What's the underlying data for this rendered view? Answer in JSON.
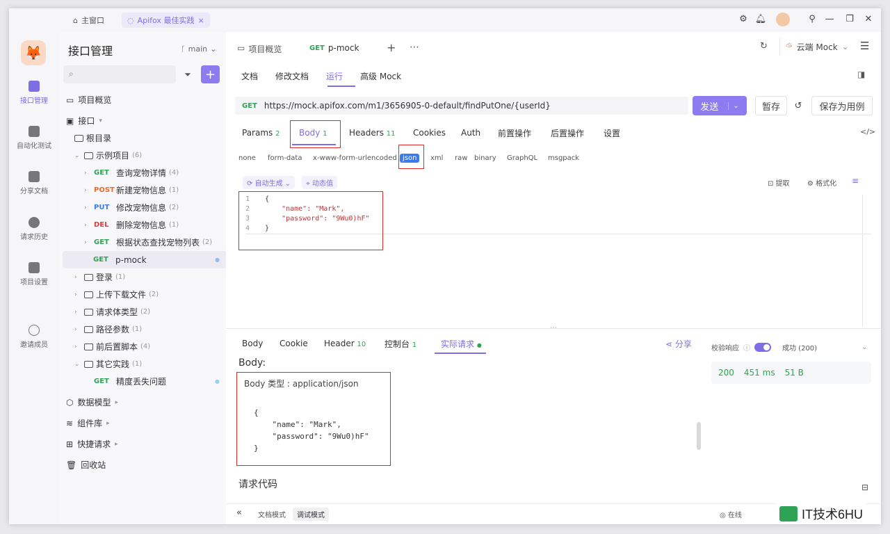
{
  "titlebar": {
    "home_tab": "主窗口",
    "active_tab": "Apifox 最佳实践"
  },
  "rail": {
    "items": [
      {
        "label": "接口管理"
      },
      {
        "label": "自动化测试"
      },
      {
        "label": "分享文档"
      },
      {
        "label": "请求历史"
      },
      {
        "label": "项目设置"
      },
      {
        "label": "邀请成员"
      }
    ]
  },
  "sidebar": {
    "title": "接口管理",
    "branch": "main",
    "items": {
      "overview": "项目概览",
      "api": "接口",
      "root": "根目录",
      "example": {
        "label": "示例项目",
        "count": "(6)"
      },
      "e1": {
        "method": "GET",
        "label": "查询宠物详情",
        "count": "(4)"
      },
      "e2": {
        "method": "POST",
        "label": "新建宠物信息",
        "count": "(1)"
      },
      "e3": {
        "method": "PUT",
        "label": "修改宠物信息",
        "count": "(2)"
      },
      "e4": {
        "method": "DEL",
        "label": "删除宠物信息",
        "count": "(1)"
      },
      "e5": {
        "method": "GET",
        "label": "根据状态查找宠物列表",
        "count": "(2)"
      },
      "e6": {
        "method": "GET",
        "label": "p-mock"
      },
      "login": {
        "label": "登录",
        "count": "(1)"
      },
      "upload": {
        "label": "上传下载文件",
        "count": "(2)"
      },
      "bodytype": {
        "label": "请求体类型",
        "count": "(2)"
      },
      "pathparam": {
        "label": "路径参数",
        "count": "(1)"
      },
      "prepost": {
        "label": "前后置脚本",
        "count": "(4)"
      },
      "other": {
        "label": "其它实践",
        "count": "(1)"
      },
      "o1": {
        "method": "GET",
        "label": "精度丢失问题"
      },
      "datamodel": "数据模型",
      "components": "组件库",
      "quick": "快捷请求",
      "trash": "回收站"
    }
  },
  "main": {
    "tabs": {
      "overview": "项目概览",
      "active_method": "GET",
      "active_name": "p-mock"
    },
    "env": "云端 Mock",
    "subtabs": [
      "文档",
      "修改文档",
      "运行",
      "高级 Mock"
    ],
    "request": {
      "method": "GET",
      "url": "https://mock.apifox.com/m1/3656905-0-default/findPutOne/{userId}",
      "send": "发送",
      "save": "暂存",
      "save_case": "保存为用例"
    },
    "param_tabs": [
      {
        "label": "Params",
        "count": "2"
      },
      {
        "label": "Body",
        "count": "1"
      },
      {
        "label": "Headers",
        "count": "11"
      },
      {
        "label": "Cookies",
        "count": ""
      },
      {
        "label": "Auth",
        "count": ""
      },
      {
        "label": "前置操作",
        "count": ""
      },
      {
        "label": "后置操作",
        "count": ""
      },
      {
        "label": "设置",
        "count": ""
      }
    ],
    "body_types": [
      "none",
      "form-data",
      "x-www-form-urlencoded",
      "json",
      "xml",
      "raw",
      "binary",
      "GraphQL",
      "msgpack"
    ],
    "toolbar": {
      "auto": "自动生成",
      "dynamic": "动态值",
      "extract": "提取",
      "format": "格式化"
    },
    "editor_lines": [
      {
        "n": "1",
        "t": "{"
      },
      {
        "n": "2",
        "t": "    \"name\": \"Mark\","
      },
      {
        "n": "3",
        "t": "    \"password\": \"9Wu0)hF\""
      },
      {
        "n": "4",
        "t": "}"
      }
    ],
    "resp_tabs": [
      {
        "label": "Body",
        "count": ""
      },
      {
        "label": "Cookie",
        "count": ""
      },
      {
        "label": "Header",
        "count": "10"
      },
      {
        "label": "控制台",
        "count": "1"
      },
      {
        "label": "实际请求",
        "count": ""
      }
    ],
    "share": "分享",
    "validate": {
      "label": "校验响应",
      "result": "成功 (200)"
    },
    "stats": {
      "status": "200",
      "time": "451 ms",
      "size": "51 B"
    },
    "actual": {
      "body_heading": "Body:",
      "body_type": "Body 类型 : application/json",
      "lines": [
        "{",
        "    \"name\": \"Mark\",",
        "    \"password\": \"9Wu0)hF\"",
        "}"
      ],
      "code_heading": "请求代码"
    },
    "footer": {
      "doc_mode": "文档模式",
      "debug_mode": "调试模式",
      "online": "在线",
      "watermark": "IT技术6HU"
    }
  },
  "colors": {
    "accent": "#7d6ee6",
    "get": "#2fa355",
    "post": "#f06a2c",
    "put": "#3a7cf0",
    "del": "#e03d3d",
    "highlight": "#e02a2a"
  }
}
